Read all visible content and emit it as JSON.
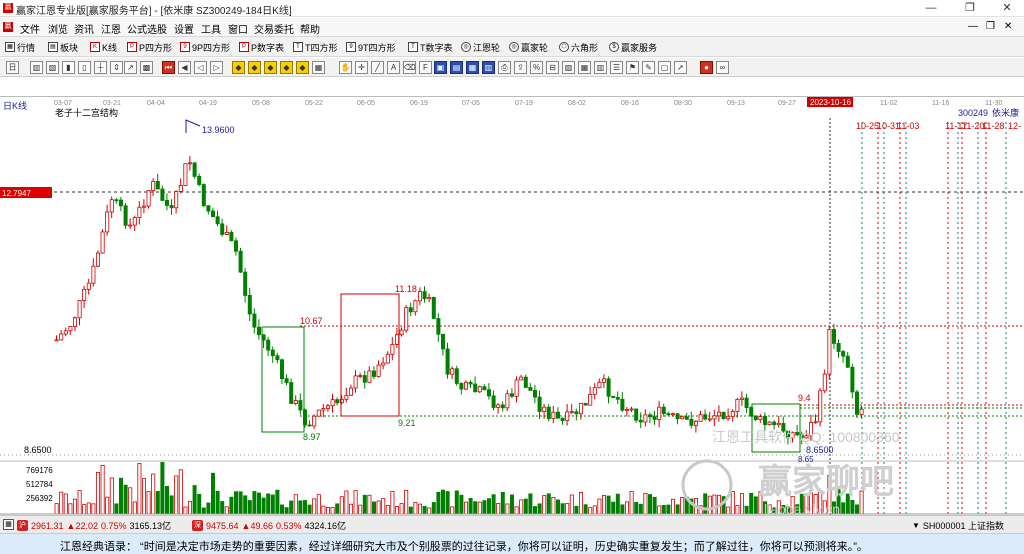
{
  "window": {
    "title": "赢家江恩专业版[赢家服务平台] - [依米康  SZ300249-184日K线]",
    "minimize": "—",
    "restore": "❐",
    "close": "✕"
  },
  "menu": [
    "文件",
    "浏览",
    "资讯",
    "江恩",
    "公式选股",
    "设置",
    "工具",
    "窗口",
    "交易委托",
    "帮助"
  ],
  "mdi_controls": [
    "—",
    "❐",
    "✕"
  ],
  "toolbar1": [
    {
      "label": "行情",
      "icon": "grid-icon"
    },
    {
      "label": "板块",
      "icon": "blocks-icon"
    },
    {
      "label": "K线",
      "icon": "candle-icon"
    },
    {
      "label": "P四方形",
      "icon": "square-p-icon"
    },
    {
      "label": "9P四方形",
      "icon": "square-9p-icon"
    },
    {
      "label": "P数字表",
      "icon": "table-p-icon"
    },
    {
      "label": "T四方形",
      "icon": "square-t-icon"
    },
    {
      "label": "9T四方形",
      "icon": "square-9t-icon"
    },
    {
      "label": "T数字表",
      "icon": "table-t-icon"
    },
    {
      "label": "江恩轮",
      "icon": "wheel-icon"
    },
    {
      "label": "赢家轮",
      "icon": "wheel-icon"
    },
    {
      "label": "六角形",
      "icon": "hexagon-icon"
    },
    {
      "label": "赢家服务",
      "icon": "dollar-icon"
    }
  ],
  "chart": {
    "period": "日K线",
    "title": "老子十二宫结构",
    "stock_code": "300249",
    "stock_name": "依米康",
    "current_price_tag": "12.7947",
    "date_axis": [
      "03-07",
      "03-21",
      "04-04",
      "04-19",
      "05-08",
      "05-22",
      "06-05",
      "06-19",
      "07-05",
      "07-19",
      "08-02",
      "08-16",
      "08-30",
      "09-13",
      "09-27",
      "2023-10-16",
      "11-02",
      "11-16",
      "11-30"
    ],
    "price_labels": {
      "high": "13.9600",
      "left_low": "8.97",
      "rebound_high": "11.18",
      "level_1067": "10.67",
      "level_921": "9.21",
      "level_94": "9.4",
      "low_label": "8.6500",
      "low_label2": "8.65",
      "axis_min": "8.6500"
    },
    "future_dates_left": [
      "10-25",
      "10-31",
      "11-03"
    ],
    "future_dates_right": [
      "11-17",
      "11-20",
      "11-28",
      "12-"
    ],
    "volume_axis": [
      "769176",
      "512784",
      "256392"
    ],
    "watermark_qq": "江恩工具软件  QQ: 100800360",
    "watermark_brand": "赢家聊吧",
    "watermark_url": "liaoba.yjv.cn"
  },
  "status": {
    "sh_value": "2961.31",
    "sh_change": "▲22.02",
    "sh_pct": "0.75%",
    "sh_amount": "3165.13亿",
    "sz_value": "9475.64",
    "sz_change": "▲49.66",
    "sz_pct": "0.53%",
    "sz_amount": "4324.16亿",
    "index_select": "SH000001 上证指数"
  },
  "quote": "江恩经典语录：  “时间是决定市场走势的重要因素，经过详细研究大市及个别股票的过往记录，你将可以证明，历史确实重复发生；而了解过往，你将可以预测将来。”。",
  "colors": {
    "up": "#d00000",
    "down": "#008000",
    "accent": "#1a1aa0"
  }
}
